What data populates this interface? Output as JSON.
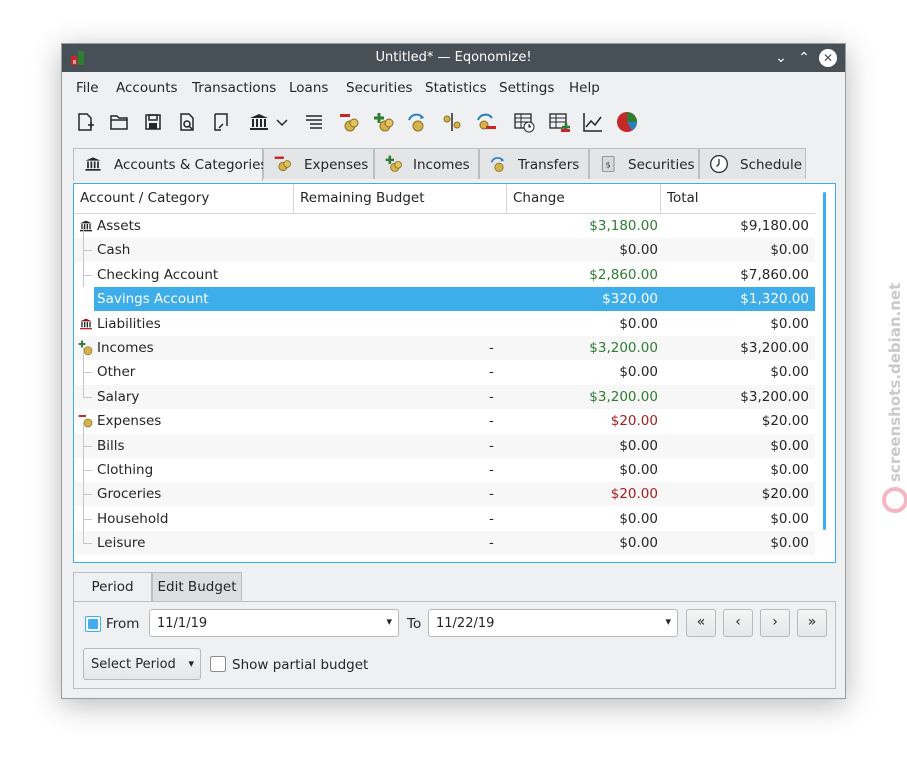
{
  "window": {
    "title": "Untitled* — Eqonomize!",
    "controls": [
      "minimize-icon",
      "maximize-icon",
      "close-icon"
    ]
  },
  "menu": [
    "File",
    "Accounts",
    "Transactions",
    "Loans",
    "Securities",
    "Statistics",
    "Settings",
    "Help"
  ],
  "toolbar_icons": [
    "new-file-icon",
    "open-file-icon",
    "save-icon",
    "print-preview-icon",
    "save-as-icon",
    "bank-icon",
    "dropdown-icon",
    "ledger-icon",
    "new-expense-icon",
    "new-income-icon",
    "new-transfer-icon",
    "split-icon",
    "delete-transaction-icon",
    "schedule-icon",
    "table-icon",
    "line-chart-icon",
    "pie-chart-icon"
  ],
  "tabs": [
    {
      "label": "Accounts & Categories",
      "icon": "bank-icon"
    },
    {
      "label": "Expenses",
      "icon": "expense-coins-icon"
    },
    {
      "label": "Incomes",
      "icon": "income-coins-icon"
    },
    {
      "label": "Transfers",
      "icon": "transfer-icon"
    },
    {
      "label": "Securities",
      "icon": "securities-icon"
    },
    {
      "label": "Schedule",
      "icon": "clock-icon"
    }
  ],
  "tree": {
    "columns": [
      "Account / Category",
      "Remaining Budget",
      "Change",
      "Total"
    ],
    "rows": [
      {
        "name": "Assets",
        "level": 0,
        "icon": "bank-icon",
        "budget": "",
        "change": "$3,180.00",
        "change_color": "green",
        "total": "$9,180.00"
      },
      {
        "name": "Cash",
        "level": 1,
        "budget": "",
        "change": "$0.00",
        "change_color": "",
        "total": "$0.00"
      },
      {
        "name": "Checking Account",
        "level": 1,
        "budget": "",
        "change": "$2,860.00",
        "change_color": "green",
        "total": "$7,860.00"
      },
      {
        "name": "Savings Account",
        "level": 1,
        "budget": "",
        "change": "$320.00",
        "change_color": "green",
        "total": "$1,320.00",
        "selected": true
      },
      {
        "name": "Liabilities",
        "level": 0,
        "icon": "liabilities-icon",
        "budget": "",
        "change": "$0.00",
        "change_color": "",
        "total": "$0.00"
      },
      {
        "name": "Incomes",
        "level": 0,
        "icon": "income-coins-icon",
        "budget": "-",
        "change": "$3,200.00",
        "change_color": "green",
        "total": "$3,200.00"
      },
      {
        "name": "Other",
        "level": 1,
        "budget": "-",
        "change": "$0.00",
        "change_color": "",
        "total": "$0.00"
      },
      {
        "name": "Salary",
        "level": 1,
        "budget": "-",
        "change": "$3,200.00",
        "change_color": "green",
        "total": "$3,200.00"
      },
      {
        "name": "Expenses",
        "level": 0,
        "icon": "expense-coins-icon",
        "budget": "-",
        "change": "$20.00",
        "change_color": "red",
        "total": "$20.00"
      },
      {
        "name": "Bills",
        "level": 1,
        "budget": "-",
        "change": "$0.00",
        "change_color": "",
        "total": "$0.00"
      },
      {
        "name": "Clothing",
        "level": 1,
        "budget": "-",
        "change": "$0.00",
        "change_color": "",
        "total": "$0.00"
      },
      {
        "name": "Groceries",
        "level": 1,
        "budget": "-",
        "change": "$20.00",
        "change_color": "red",
        "total": "$20.00"
      },
      {
        "name": "Household",
        "level": 1,
        "budget": "-",
        "change": "$0.00",
        "change_color": "",
        "total": "$0.00"
      },
      {
        "name": "Leisure",
        "level": 1,
        "budget": "-",
        "change": "$0.00",
        "change_color": "",
        "total": "$0.00"
      }
    ]
  },
  "bottom": {
    "tabs": [
      "Period",
      "Edit Budget"
    ],
    "from_label": "From",
    "from_checked": true,
    "from_date": "11/1/19",
    "to_label": "To",
    "to_date": "11/22/19",
    "nav_buttons": [
      "«",
      "‹",
      "›",
      "»"
    ],
    "select_period": "Select Period",
    "show_partial_label": "Show partial budget",
    "show_partial_checked": false
  },
  "watermark": "screenshots.debian.net",
  "colors": {
    "accent": "#3daee9",
    "positive": "#2e7d32",
    "negative": "#a32020",
    "titlebar": "#475057"
  }
}
